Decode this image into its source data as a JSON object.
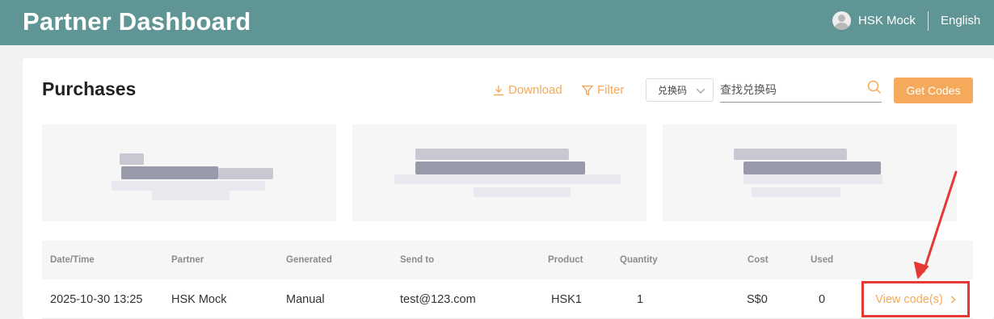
{
  "header": {
    "brand": "Partner Dashboard",
    "user_name": "HSK Mock",
    "language": "English",
    "bg_color": "#5f9594"
  },
  "main": {
    "title": "Purchases",
    "toolbar": {
      "download_label": "Download",
      "filter_label": "Filter",
      "search_type": "兑换码",
      "search_placeholder": "查找兑换码",
      "get_codes_label": "Get Codes",
      "accent_color": "#f5a95b"
    },
    "table": {
      "columns": [
        "Date/Time",
        "Partner",
        "Generated",
        "Send to",
        "Product",
        "Quantity",
        "Cost",
        "Used"
      ],
      "rows": [
        {
          "datetime": "2025-10-30 13:25",
          "partner": "HSK Mock",
          "generated": "Manual",
          "send_to": "test@123.com",
          "product": "HSK1",
          "quantity": "1",
          "cost": "S$0",
          "used": "0",
          "action": "View code(s)"
        }
      ]
    }
  },
  "annotation": {
    "color": "#e53935"
  }
}
